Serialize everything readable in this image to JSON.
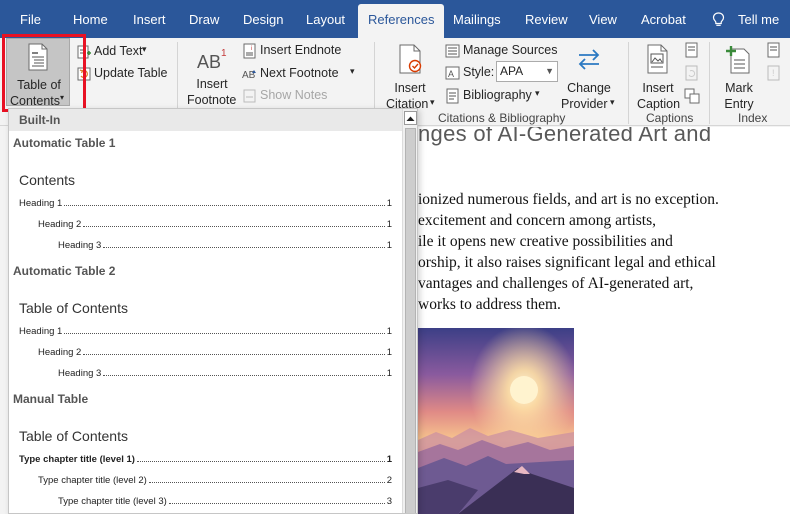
{
  "tabs": [
    "File",
    "Home",
    "Insert",
    "Draw",
    "Design",
    "Layout",
    "References",
    "Mailings",
    "Review",
    "View",
    "Acrobat"
  ],
  "active_tab": "References",
  "tell_me": "Tell me",
  "ribbon": {
    "toc": {
      "line1": "Table of",
      "line2": "Contents"
    },
    "add_text": "Add Text",
    "update_table": "Update Table",
    "insert_footnote": {
      "line1": "Insert",
      "line2": "Footnote"
    },
    "insert_endnote": "Insert Endnote",
    "next_footnote": "Next Footnote",
    "show_notes": "Show Notes",
    "insert_citation": {
      "line1": "Insert",
      "line2": "Citation"
    },
    "manage_sources": "Manage Sources",
    "style_label": "Style:",
    "style_value": "APA",
    "bibliography": "Bibliography",
    "change_provider": {
      "line1": "Change",
      "line2": "Provider"
    },
    "group_citations": "Citations & Bibliography",
    "insert_caption": {
      "line1": "Insert",
      "line2": "Caption"
    },
    "group_captions": "Captions",
    "mark_entry": {
      "line1": "Mark",
      "line2": "Entry"
    },
    "group_index": "Index"
  },
  "document": {
    "title_fragment": "nges of AI-Generated Art and",
    "lines": [
      "ionized numerous fields, and art is no exception.",
      " excitement and concern among artists,",
      "ile it opens new creative possibilities and",
      "orship, it also raises significant legal and ethical",
      "vantages and challenges of AI-generated art,",
      "works to address them."
    ]
  },
  "gallery": {
    "header": "Built-In",
    "auto1": {
      "name": "Automatic Table 1",
      "title": "Contents",
      "entries": [
        {
          "text": "Heading 1",
          "page": "1"
        },
        {
          "text": "Heading 2",
          "page": "1"
        },
        {
          "text": "Heading 3",
          "page": "1"
        }
      ]
    },
    "auto2": {
      "name": "Automatic Table 2",
      "title": "Table of Contents",
      "entries": [
        {
          "text": "Heading 1",
          "page": "1"
        },
        {
          "text": "Heading 2",
          "page": "1"
        },
        {
          "text": "Heading 3",
          "page": "1"
        }
      ]
    },
    "manual": {
      "name": "Manual Table",
      "title": "Table of Contents",
      "entries": [
        {
          "text": "Type chapter title (level 1)",
          "page": "1"
        },
        {
          "text": "Type chapter title (level 2)",
          "page": "2"
        },
        {
          "text": "Type chapter title (level 3)",
          "page": "3"
        }
      ]
    }
  },
  "colors": {
    "word_blue": "#2b579a",
    "highlight_red": "#e81123"
  }
}
